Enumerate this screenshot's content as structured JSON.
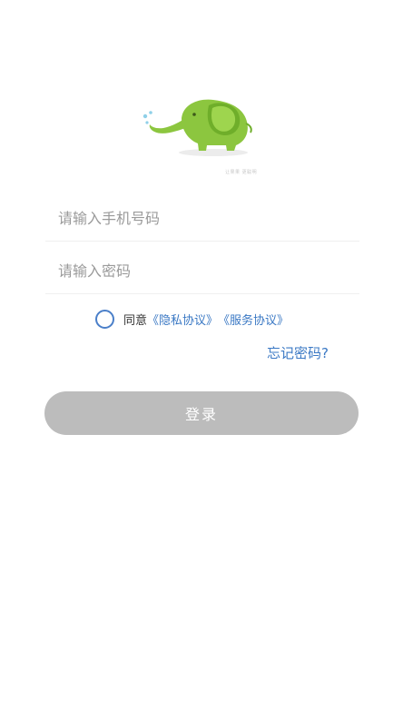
{
  "logo": {
    "icon": "elephant-logo-icon",
    "tagline": "让果果 更聪明"
  },
  "form": {
    "phone_placeholder": "请输入手机号码",
    "phone_value": "",
    "password_placeholder": "请输入密码",
    "password_value": ""
  },
  "agreement": {
    "checked": false,
    "prefix": "同意",
    "privacy_link": "《隐私协议》",
    "service_link": "《服务协议》"
  },
  "forgot_password": "忘记密码?",
  "login_button": "登录",
  "colors": {
    "brand_green": "#8cc63f",
    "link_blue": "#3a78c4",
    "button_disabled": "#bcbcbc"
  }
}
